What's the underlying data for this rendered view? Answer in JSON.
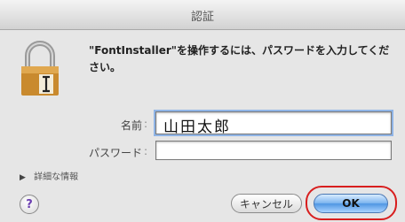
{
  "window": {
    "title": "認証"
  },
  "dialog": {
    "message": "\"FontInstaller\"を操作するには、パスワードを入力してください。",
    "name_label": "名前",
    "name_value": "山田太郎",
    "password_label": "パスワード",
    "password_value": "",
    "details_label": "詳細な情報",
    "help_label": "?",
    "cancel_label": "キャンセル",
    "ok_label": "OK"
  },
  "colors": {
    "highlight": "#d81e1e",
    "ok_button": "#4f96e3"
  }
}
